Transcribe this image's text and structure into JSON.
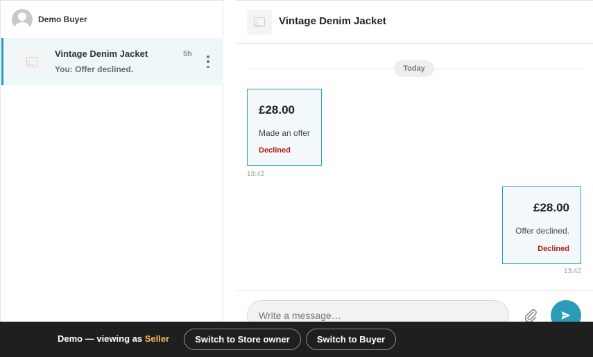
{
  "sidebar": {
    "user_name": "Demo Buyer",
    "conversations": [
      {
        "title": "Vintage Denim Jacket",
        "subtitle": "You: Offer declined.",
        "time": "5h"
      }
    ]
  },
  "chat": {
    "title": "Vintage Denim Jacket",
    "day_label": "Today",
    "messages": [
      {
        "side": "left",
        "price": "£28.00",
        "text": "Made an offer",
        "status": "Declined",
        "time": "13:42"
      },
      {
        "side": "right",
        "price": "£28.00",
        "text": "Offer declined.",
        "status": "Declined",
        "time": "13:42"
      }
    ],
    "composer_placeholder": "Write a message…"
  },
  "demo_bar": {
    "prefix": "Demo — viewing as ",
    "role": "Seller",
    "switch_store_owner": "Switch to Store owner",
    "switch_buyer": "Switch to Buyer"
  },
  "colors": {
    "accent": "#2a9bb8",
    "declined": "#b31b1b",
    "demo_role": "#f5b94a",
    "demo_bar_bg": "#1f1f1f"
  }
}
